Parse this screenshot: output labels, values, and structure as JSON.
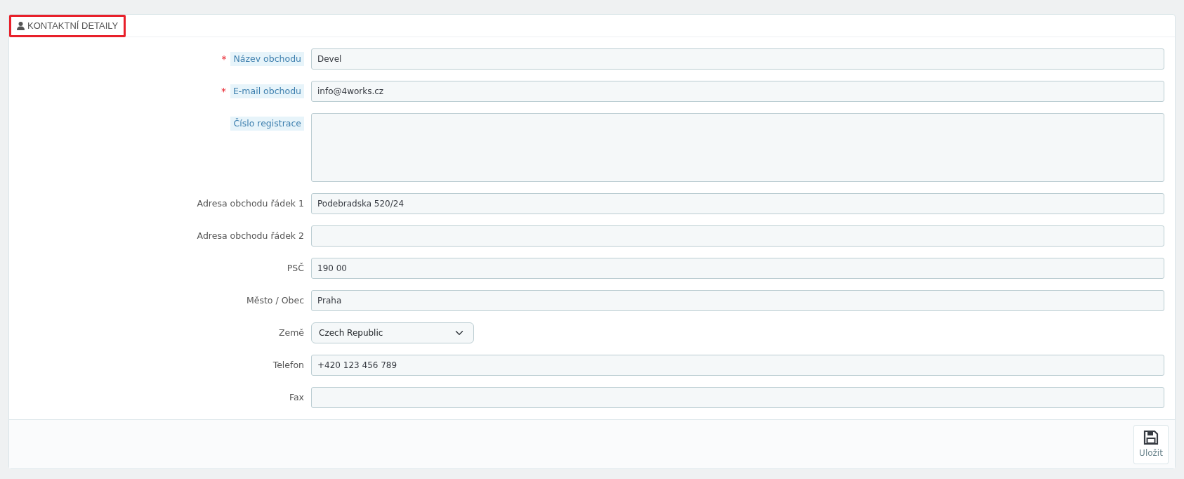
{
  "panel": {
    "title": "KONTAKTNÍ DETAILY",
    "highlighted": true
  },
  "fields": [
    {
      "kind": "text",
      "label": "Název obchodu",
      "required_mark": "*",
      "hint": true,
      "value": "Devel"
    },
    {
      "kind": "text",
      "label": "E-mail obchodu",
      "required_mark": "*",
      "hint": true,
      "value": "info@4works.cz"
    },
    {
      "kind": "textarea",
      "label": "Číslo registrace",
      "hint": true
    },
    {
      "kind": "text",
      "label": "Adresa obchodu řádek 1",
      "hint": false,
      "value": "Podebradska 520/24"
    },
    {
      "kind": "text",
      "label": "Adresa obchodu řádek 2",
      "hint": false
    },
    {
      "kind": "text",
      "label": "PSČ",
      "hint": false,
      "value": "190 00"
    },
    {
      "kind": "text",
      "label": "Město / Obec",
      "hint": false,
      "value": "Praha"
    },
    {
      "kind": "select",
      "label": "Země",
      "hint": false,
      "value": "Czech Republic"
    },
    {
      "kind": "text",
      "label": "Telefon",
      "hint": false,
      "value": "+420 123 456 789"
    },
    {
      "kind": "text",
      "label": "Fax",
      "hint": false
    }
  ],
  "save_button": {
    "label": "Uložit"
  }
}
